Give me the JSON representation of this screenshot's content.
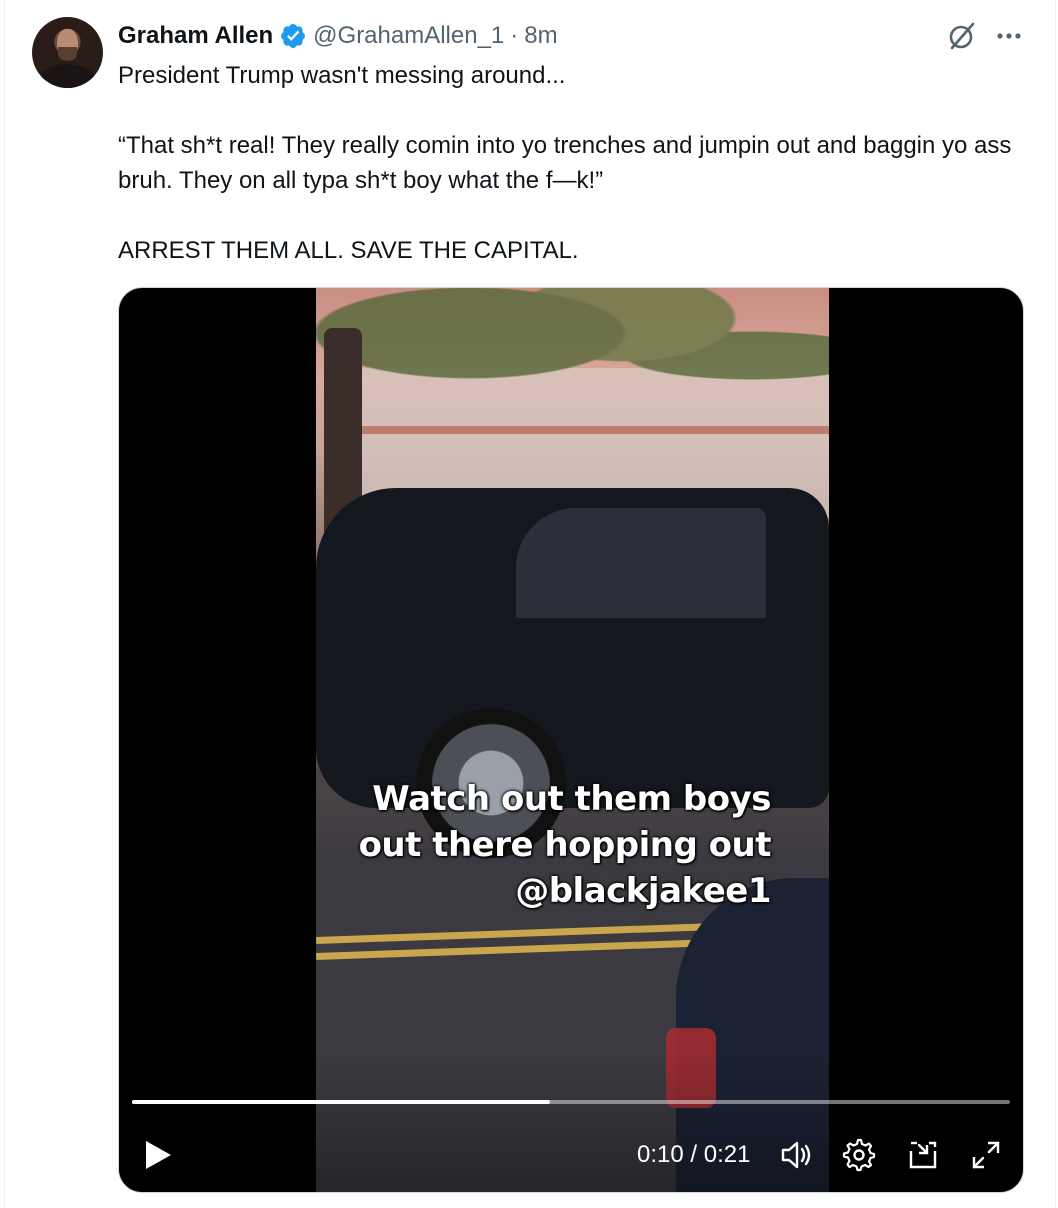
{
  "tweet": {
    "author": {
      "display_name": "Graham Allen",
      "verified": true,
      "handle": "@GrahamAllen_1",
      "separator": "·",
      "time": "8m"
    },
    "paragraphs": [
      "President Trump wasn't messing around...",
      "“That sh*t real! They really comin into yo trenches and jumpin out and baggin yo ass bruh. They on all typa sh*t boy what the f—k!”",
      "ARREST THEM ALL. SAVE THE CAPITAL."
    ],
    "actions": {
      "grok_icon": "grok-icon",
      "more_icon": "more-icon"
    }
  },
  "video": {
    "caption_lines": [
      "Watch out them boys",
      "out there hopping out",
      "@blackjakee1"
    ],
    "progress": 0.476,
    "time": "0:10 / 0:21",
    "controls": [
      "play-icon",
      "volume-icon",
      "settings-icon",
      "pip-icon",
      "fullscreen-icon"
    ]
  },
  "colors": {
    "verified": "#1d9bf0",
    "text": "#0f1419",
    "secondary": "#536471"
  }
}
